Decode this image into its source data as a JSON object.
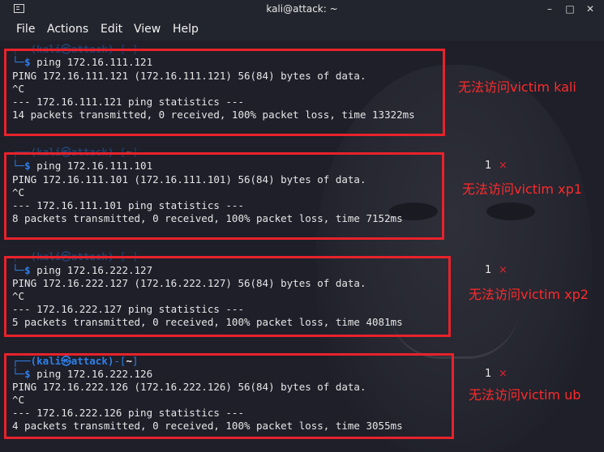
{
  "window": {
    "title": "kali@attack: ~",
    "minimize": "–",
    "maximize": "□",
    "close": "✕"
  },
  "menu": [
    "File",
    "Actions",
    "Edit",
    "View",
    "Help"
  ],
  "prompt": {
    "frame_open": "┌──",
    "user_host": "(kali㉿attack)",
    "sep": "-[",
    "path": "~",
    "close": "]",
    "corner": "└─",
    "dollar": "$"
  },
  "blocks": [
    {
      "command": "ping 172.16.111.121",
      "header": "PING 172.16.111.121 (172.16.111.121) 56(84) bytes of data.",
      "interrupt": "^C",
      "stats_title": "--- 172.16.111.121 ping statistics ---",
      "stats": "14 packets transmitted, 0 received, 100% packet loss, time 13322ms",
      "annotation": "无法访问victim kali"
    },
    {
      "command": "ping 172.16.111.101",
      "header": "PING 172.16.111.101 (172.16.111.101) 56(84) bytes of data.",
      "interrupt": "^C",
      "stats_title": "--- 172.16.111.101 ping statistics ---",
      "stats": "8 packets transmitted, 0 received, 100% packet loss, time 7152ms",
      "annotation": "无法访问victim xp1",
      "count": "1",
      "mark": "×"
    },
    {
      "command": "ping 172.16.222.127",
      "header": "PING 172.16.222.127 (172.16.222.127) 56(84) bytes of data.",
      "interrupt": "^C",
      "stats_title": "--- 172.16.222.127 ping statistics ---",
      "stats": "5 packets transmitted, 0 received, 100% packet loss, time 4081ms",
      "annotation": "无法访问victim xp2",
      "count": "1",
      "mark": "×"
    },
    {
      "command": "ping 172.16.222.126",
      "header": "PING 172.16.222.126 (172.16.222.126) 56(84) bytes of data.",
      "interrupt": "^C",
      "stats_title": "--- 172.16.222.126 ping statistics ---",
      "stats": "4 packets transmitted, 0 received, 100% packet loss, time 3055ms",
      "annotation": "无法访问victim ub",
      "count": "1",
      "mark": "×"
    }
  ],
  "colors": {
    "background": "#1e1f29",
    "prompt_blue": "#2f7fe8",
    "highlight_red": "#e8222b",
    "annotation_red": "#ff2a2a"
  }
}
